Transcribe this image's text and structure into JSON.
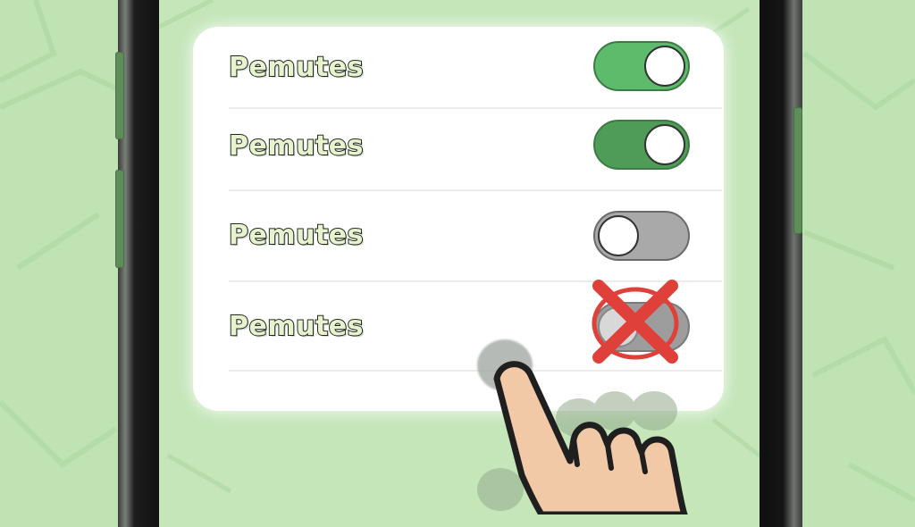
{
  "settings": {
    "items": [
      {
        "label": "Pemutes",
        "state": "on"
      },
      {
        "label": "Pemutes",
        "state": "on"
      },
      {
        "label": "Pemutes",
        "state": "off"
      },
      {
        "label": "Pemutes",
        "state": "disabled"
      }
    ]
  },
  "colors": {
    "background": "#bfe3b3",
    "toggle_on": "#5dbb6c",
    "toggle_off": "#a9a9a9",
    "error_mark": "#e0403a",
    "hand_skin": "#f2c9a7"
  },
  "icons": {
    "pointer": "hand-pointer-icon",
    "blocked": "red-x-icon"
  }
}
